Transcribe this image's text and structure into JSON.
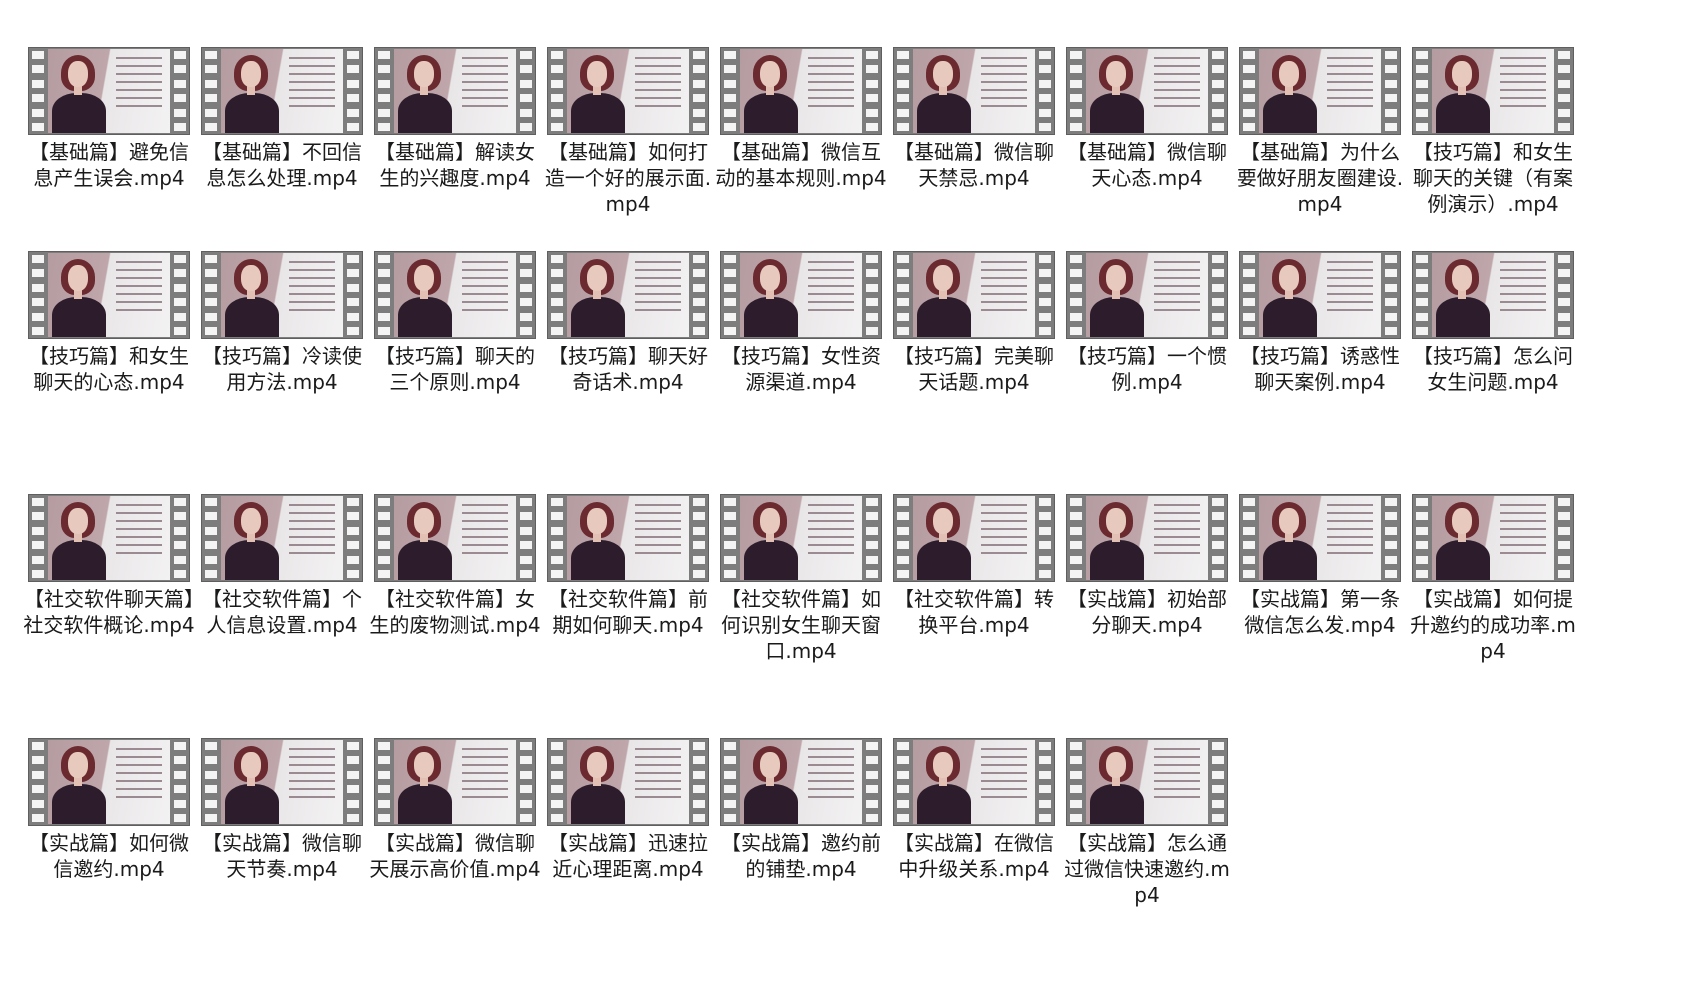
{
  "files": [
    {
      "name": "【基础篇】避免信息产生误会.mp4",
      "icon": "video-thumbnail"
    },
    {
      "name": "【基础篇】不回信息怎么处理.mp4",
      "icon": "video-thumbnail"
    },
    {
      "name": "【基础篇】解读女生的兴趣度.mp4",
      "icon": "video-thumbnail"
    },
    {
      "name": "【基础篇】如何打造一个好的展示面.mp4",
      "icon": "video-thumbnail"
    },
    {
      "name": "【基础篇】微信互动的基本规则.mp4",
      "icon": "video-thumbnail"
    },
    {
      "name": "【基础篇】微信聊天禁忌.mp4",
      "icon": "video-thumbnail"
    },
    {
      "name": "【基础篇】微信聊天心态.mp4",
      "icon": "video-thumbnail"
    },
    {
      "name": "【基础篇】为什么要做好朋友圈建设.mp4",
      "icon": "video-thumbnail"
    },
    {
      "name": "【技巧篇】和女生聊天的关键（有案例演示）.mp4",
      "icon": "video-thumbnail"
    },
    {
      "name": "【技巧篇】和女生聊天的心态.mp4",
      "icon": "video-thumbnail"
    },
    {
      "name": "【技巧篇】冷读使用方法.mp4",
      "icon": "video-thumbnail"
    },
    {
      "name": "【技巧篇】聊天的三个原则.mp4",
      "icon": "video-thumbnail"
    },
    {
      "name": "【技巧篇】聊天好奇话术.mp4",
      "icon": "video-thumbnail"
    },
    {
      "name": "【技巧篇】女性资源渠道.mp4",
      "icon": "video-thumbnail"
    },
    {
      "name": "【技巧篇】完美聊天话题.mp4",
      "icon": "video-thumbnail"
    },
    {
      "name": "【技巧篇】一个惯例.mp4",
      "icon": "video-thumbnail"
    },
    {
      "name": "【技巧篇】诱惑性聊天案例.mp4",
      "icon": "video-thumbnail"
    },
    {
      "name": "【技巧篇】怎么问女生问题.mp4",
      "icon": "video-thumbnail"
    },
    {
      "name": "【社交软件聊天篇】社交软件概论.mp4",
      "icon": "video-thumbnail"
    },
    {
      "name": "【社交软件篇】个人信息设置.mp4",
      "icon": "video-thumbnail"
    },
    {
      "name": "【社交软件篇】女生的废物测试.mp4",
      "icon": "video-thumbnail"
    },
    {
      "name": "【社交软件篇】前期如何聊天.mp4",
      "icon": "video-thumbnail"
    },
    {
      "name": "【社交软件篇】如何识别女生聊天窗口.mp4",
      "icon": "video-thumbnail"
    },
    {
      "name": "【社交软件篇】转换平台.mp4",
      "icon": "video-thumbnail"
    },
    {
      "name": "【实战篇】初始部分聊天.mp4",
      "icon": "video-thumbnail"
    },
    {
      "name": "【实战篇】第一条微信怎么发.mp4",
      "icon": "video-thumbnail"
    },
    {
      "name": "【实战篇】如何提升邀约的成功率.mp4",
      "icon": "video-thumbnail"
    },
    {
      "name": "【实战篇】如何微信邀约.mp4",
      "icon": "video-thumbnail"
    },
    {
      "name": "【实战篇】微信聊天节奏.mp4",
      "icon": "video-thumbnail"
    },
    {
      "name": "【实战篇】微信聊天展示高价值.mp4",
      "icon": "video-thumbnail"
    },
    {
      "name": "【实战篇】迅速拉近心理距离.mp4",
      "icon": "video-thumbnail"
    },
    {
      "name": "【实战篇】邀约前的铺垫.mp4",
      "icon": "video-thumbnail"
    },
    {
      "name": "【实战篇】在微信中升级关系.mp4",
      "icon": "video-thumbnail"
    },
    {
      "name": "【实战篇】怎么通过微信快速邀约.mp4",
      "icon": "video-thumbnail"
    }
  ]
}
